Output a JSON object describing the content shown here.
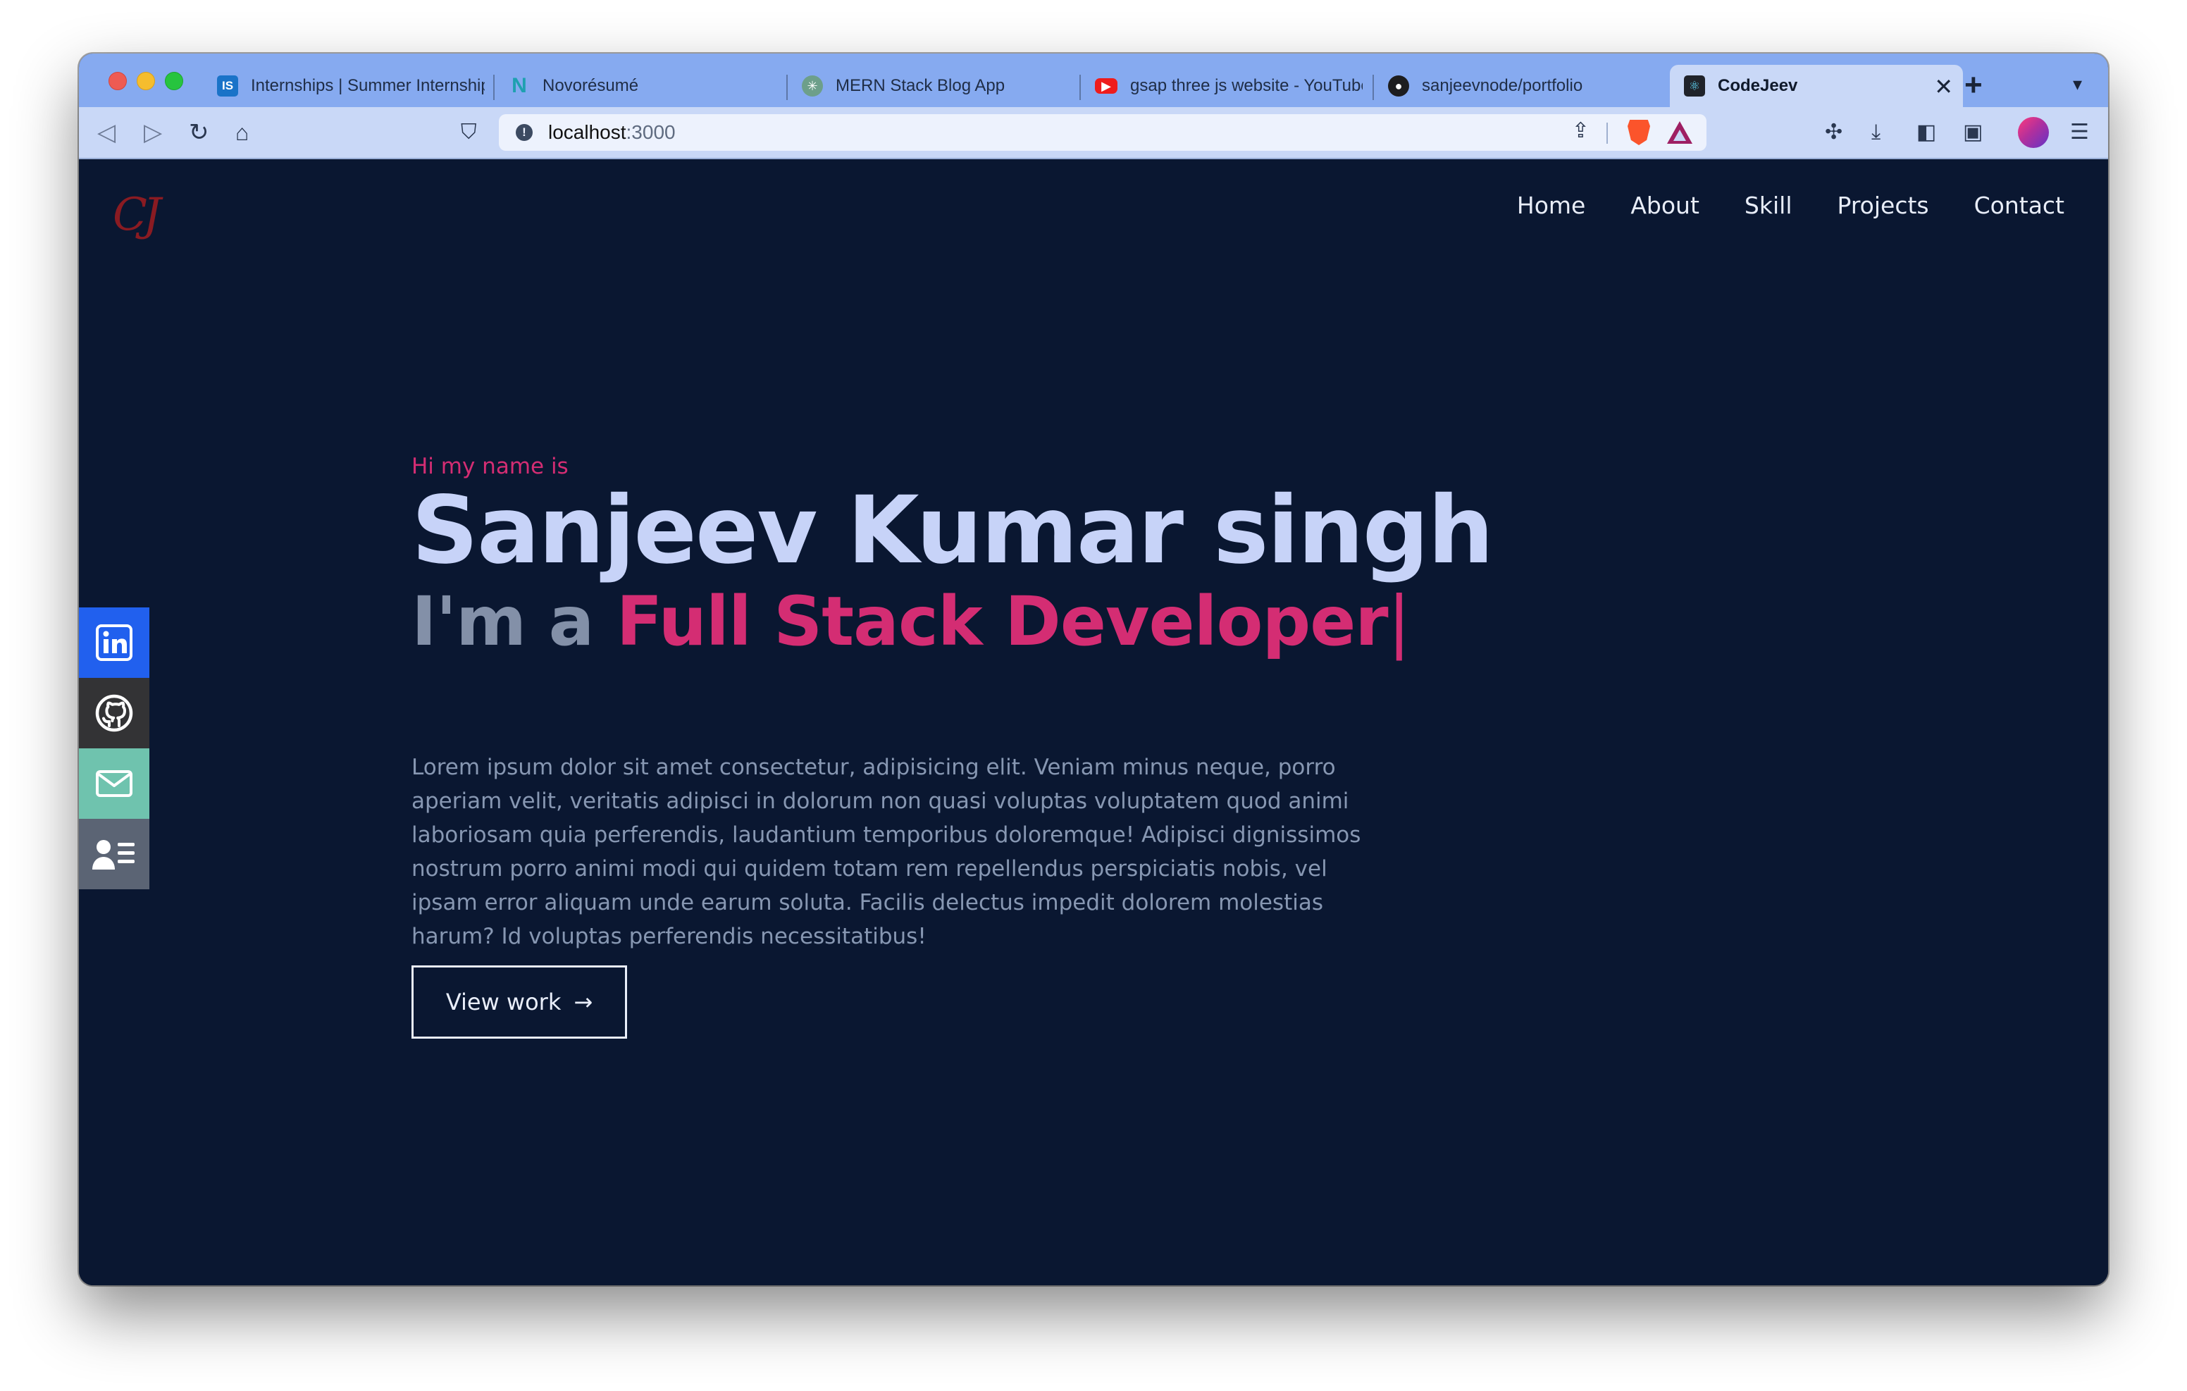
{
  "browser": {
    "tabs": [
      {
        "label": "Internships | Summer Internships",
        "favicon": "IS",
        "icon": "internshala-icon"
      },
      {
        "label": "Novorésumé",
        "favicon": "N",
        "icon": "novoresume-icon"
      },
      {
        "label": "MERN Stack Blog App",
        "favicon": "✳",
        "icon": "chatgpt-icon"
      },
      {
        "label": "gsap three js website - YouTube",
        "favicon": "▶",
        "icon": "youtube-icon"
      },
      {
        "label": "sanjeevnode/portfolio",
        "favicon": "●",
        "icon": "github-icon"
      },
      {
        "label": "CodeJeev",
        "favicon": "⚛",
        "icon": "react-icon",
        "active": true
      }
    ],
    "url": {
      "host": "localhost",
      "port": ":3000"
    }
  },
  "site": {
    "logo": "CJ",
    "nav": [
      "Home",
      "About",
      "Skill",
      "Projects",
      "Contact"
    ],
    "hero": {
      "greeting": "Hi my name is",
      "name": "Sanjeev Kumar singh",
      "role_prefix": "I'm a",
      "role": "Full Stack Developer",
      "caret": "|",
      "bio": "Lorem ipsum dolor sit amet consectetur, adipisicing elit. Veniam minus neque, porro aperiam velit, veritatis adipisci in dolorum non quasi voluptas voluptatem quod animi laboriosam quia perferendis, laudantium temporibus doloremque! Adipisci dignissimos nostrum porro animi modi qui quidem totam rem repellendus perspiciatis nobis, vel ipsam error aliquam unde earum soluta. Facilis delectus impedit dolorem molestias harum? Id voluptas perferendis necessitatibus!",
      "cta": "View work",
      "cta_arrow": "→"
    },
    "social": [
      "linkedin-icon",
      "github-icon",
      "mail-icon",
      "resume-icon"
    ]
  },
  "colors": {
    "page_bg": "#0a1731",
    "name": "#c7d3f8",
    "accent": "#d42d73",
    "muted": "#8797b2",
    "tabstrip": "#86aaf0",
    "toolbar": "#c9d8f7"
  }
}
